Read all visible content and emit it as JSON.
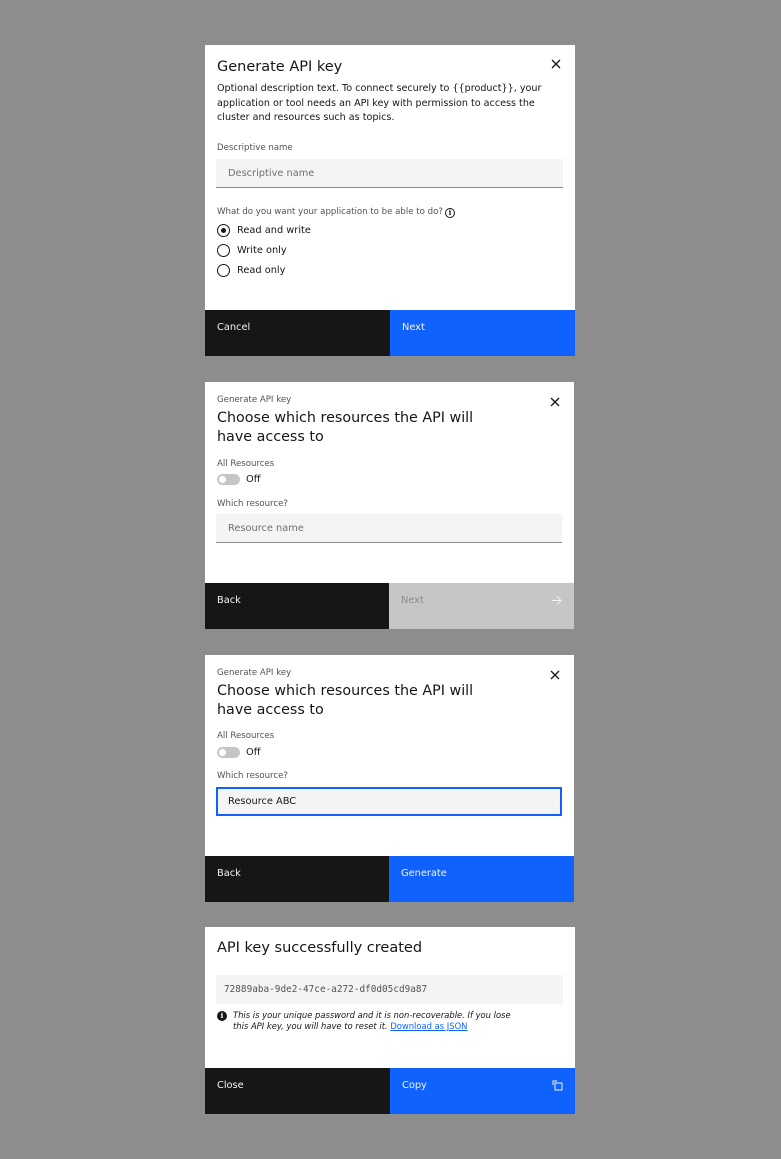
{
  "modal1": {
    "title": "Generate API key",
    "description": "Optional description text. To connect securely to {{product}}, your application or tool needs an API key with permission to access the cluster and resources such as topics.",
    "name_label": "Descriptive name",
    "name_placeholder": "Descriptive name",
    "permission_question": "What do you want your application to be able to do?",
    "options": [
      {
        "label": "Read and write",
        "checked": true
      },
      {
        "label": "Write only",
        "checked": false
      },
      {
        "label": "Read only",
        "checked": false
      }
    ],
    "cancel_label": "Cancel",
    "next_label": "Next",
    "info_icon": "i"
  },
  "modal2": {
    "eyebrow": "Generate API key",
    "heading": "Choose which resources the API will have access to",
    "all_resources_label": "All Resources",
    "toggle_state": "Off",
    "resource_label": "Which resource?",
    "resource_placeholder": "Resource name",
    "back_label": "Back",
    "next_label": "Next"
  },
  "modal3": {
    "eyebrow": "Generate API key",
    "heading": "Choose which resources the API will have access to",
    "all_resources_label": "All Resources",
    "toggle_state": "Off",
    "resource_label": "Which resource?",
    "resource_value": "Resource ABC",
    "back_label": "Back",
    "generate_label": "Generate"
  },
  "modal4": {
    "title": "API key successfully created",
    "api_key": "72889aba-9de2-47ce-a272-df0d05cd9a87",
    "note_text": "This is your unique password and it is non-recoverable. If you lose this API key, you will have to reset it.",
    "download_link": "Download as JSON",
    "close_label": "Close",
    "copy_label": "Copy",
    "info_icon": "i"
  },
  "colors": {
    "primary": "#0f62fe",
    "secondary": "#161616",
    "disabled": "#c6c6c6",
    "backdrop": "#8d8d8d"
  }
}
